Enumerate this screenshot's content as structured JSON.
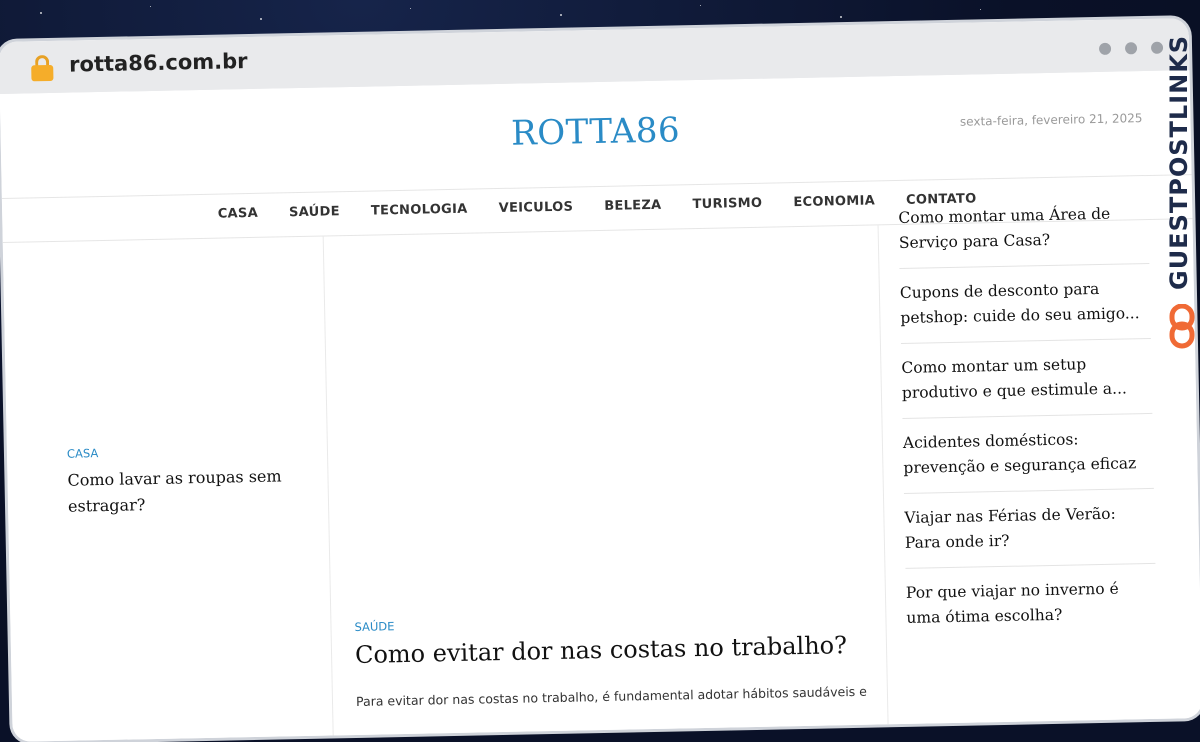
{
  "browser": {
    "url": "rotta86.com.br"
  },
  "site": {
    "logo": "ROTTA86",
    "date": "sexta-feira, fevereiro 21, 2025"
  },
  "nav": {
    "items": [
      "CASA",
      "SAÚDE",
      "TECNOLOGIA",
      "VEICULOS",
      "BELEZA",
      "TURISMO",
      "ECONOMIA",
      "CONTATO"
    ],
    "search_icon": ""
  },
  "left_post": {
    "category": "CASA",
    "title": "Como lavar as roupas sem estragar?"
  },
  "featured_post": {
    "category": "SAÚDE",
    "title": "Como evitar dor nas costas no trabalho?",
    "excerpt": "Para evitar dor nas costas no trabalho, é fundamental adotar hábitos saudáveis e"
  },
  "sidebar": {
    "items": [
      "Como montar uma Área de Serviço para Casa?",
      "Cupons de desconto para petshop: cuide do seu amigo...",
      "Como montar um setup produtivo e que estimule a...",
      "Acidentes domésticos: prevenção e segurança eficaz",
      "Viajar nas Férias de Verão: Para onde ir?",
      "Por que viajar no inverno é uma ótima escolha?"
    ]
  },
  "watermark": {
    "text": "GUESTPOSTLINKS"
  },
  "colors": {
    "accent": "#2a8bc6",
    "brand_orange": "#f06a35",
    "brand_navy": "#1e2b4a"
  }
}
